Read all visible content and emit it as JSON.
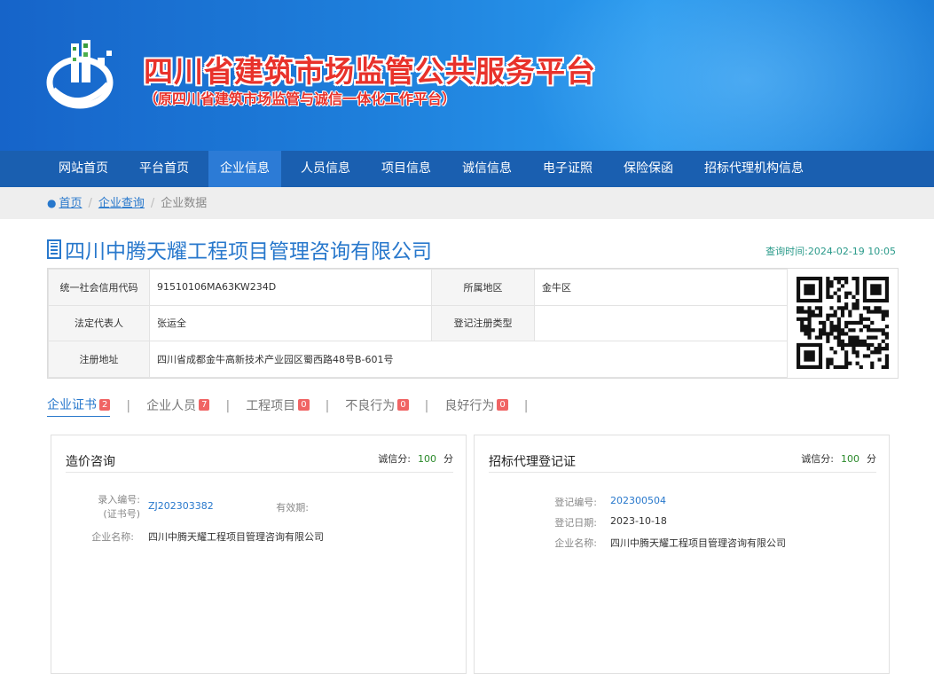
{
  "banner": {
    "title": "四川省建筑市场监管公共服务平台",
    "subtitle": "（原四川省建筑市场监管与诚信一体化工作平台）"
  },
  "nav": [
    "网站首页",
    "平台首页",
    "企业信息",
    "人员信息",
    "项目信息",
    "诚信信息",
    "电子证照",
    "保险保函",
    "招标代理机构信息"
  ],
  "breadcrumb": {
    "home": "首页",
    "query": "企业查询",
    "current": "企业数据"
  },
  "company": {
    "name": "四川中腾天耀工程项目管理咨询有限公司",
    "query_time": "查询时间:2024-02-19 10:05",
    "fields": {
      "credit_code_label": "统一社会信用代码",
      "credit_code": "91510106MA63KW234D",
      "region_label": "所属地区",
      "region": "金牛区",
      "legal_rep_label": "法定代表人",
      "legal_rep": "张运全",
      "reg_type_label": "登记注册类型",
      "reg_type": "",
      "address_label": "注册地址",
      "address": "四川省成都金牛高新技术产业园区蜀西路48号B-601号"
    }
  },
  "tabs": [
    {
      "label": "企业证书",
      "count": "2"
    },
    {
      "label": "企业人员",
      "count": "7"
    },
    {
      "label": "工程项目",
      "count": "0"
    },
    {
      "label": "不良行为",
      "count": "0"
    },
    {
      "label": "良好行为",
      "count": "0"
    }
  ],
  "cards": [
    {
      "name": "造价咨询",
      "score_label": "诚信分:",
      "score": "100",
      "score_unit": "分",
      "rows": {
        "entry_no_label_1": "录入编号:",
        "entry_no_label_2": "(证书号)",
        "entry_no": "ZJ202303382",
        "valid_label": "有效期:",
        "valid": "",
        "company_label": "企业名称:",
        "company": "四川中腾天耀工程项目管理咨询有限公司"
      }
    },
    {
      "name": "招标代理登记证",
      "score_label": "诚信分:",
      "score": "100",
      "score_unit": "分",
      "rows": {
        "reg_no_label": "登记编号:",
        "reg_no": "202300504",
        "reg_date_label": "登记日期:",
        "reg_date": "2023-10-18",
        "company_label": "企业名称:",
        "company": "四川中腾天耀工程项目管理咨询有限公司"
      }
    }
  ]
}
